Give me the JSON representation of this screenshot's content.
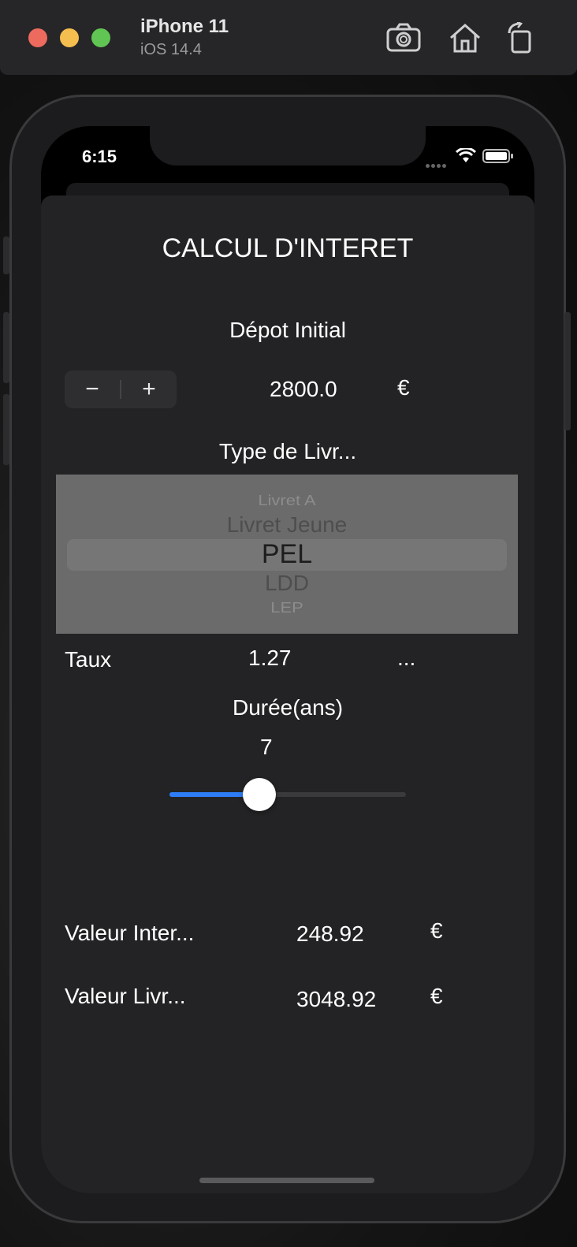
{
  "simulator": {
    "device_name": "iPhone 11",
    "os_version": "iOS 14.4",
    "icons": [
      "camera-screenshot-icon",
      "home-icon",
      "rotate-icon"
    ]
  },
  "status_bar": {
    "time": "6:15",
    "icons": [
      "cellular-signal-icon",
      "wifi-icon",
      "battery-icon"
    ]
  },
  "app": {
    "title": "CALCUL D'INTERET",
    "deposit": {
      "label": "Dépot Initial",
      "minus": "−",
      "plus": "+",
      "value": "2800.0",
      "currency": "€"
    },
    "account_type": {
      "label": "Type de Livr...",
      "options": [
        "Livret A",
        "Livret Jeune",
        "PEL",
        "LDD",
        "LEP"
      ],
      "selected": "PEL"
    },
    "rate": {
      "label": "Taux",
      "value": "1.27",
      "suffix": "..."
    },
    "duration": {
      "label": "Durée(ans)",
      "value": "7",
      "slider_fraction": 0.38
    },
    "results": {
      "interest_label": "Valeur Inter...",
      "interest_value": "248.92",
      "interest_currency": "€",
      "total_label": "Valeur Livr...",
      "total_value": "3048.92",
      "total_currency": "€"
    }
  },
  "colors": {
    "accent": "#2f7df6",
    "sheet_background": "#232325",
    "picker_background": "#6b6b6b"
  }
}
